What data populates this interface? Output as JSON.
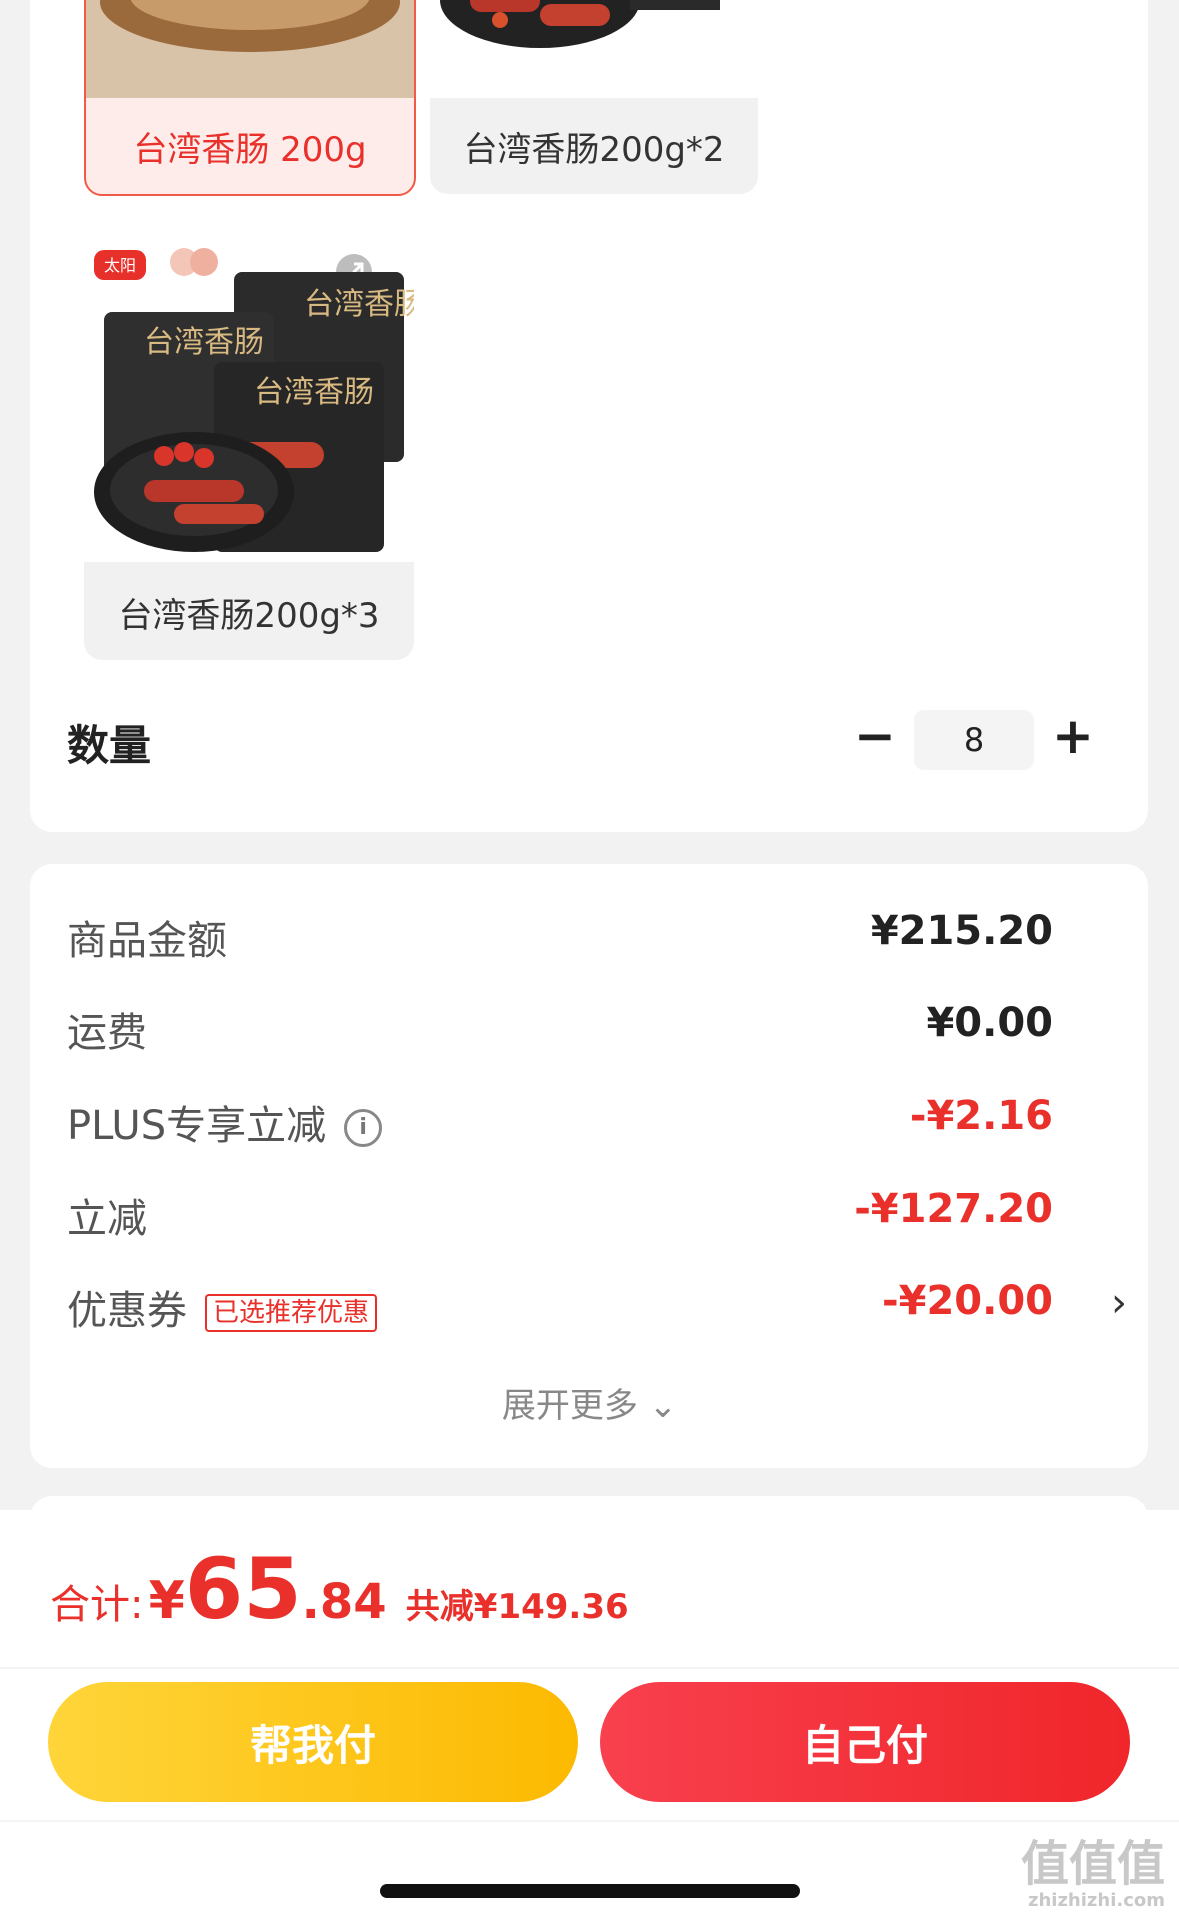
{
  "specs": [
    {
      "label": "台湾香肠 200g",
      "selected": true
    },
    {
      "label": "台湾香肠200g*2",
      "selected": false
    },
    {
      "label": "台湾香肠200g*3",
      "selected": false
    }
  ],
  "product_image": {
    "brand": "太阳",
    "bag_text": "台湾香肠"
  },
  "quantity": {
    "title": "数量",
    "minus": "−",
    "value": "8",
    "plus": "+"
  },
  "price_rows": {
    "goods_amount": {
      "label": "商品金额",
      "value": "¥215.20"
    },
    "shipping": {
      "label": "运费",
      "value": "¥0.00"
    },
    "plus_discount": {
      "label": "PLUS专享立减",
      "value": "-¥2.16",
      "icon": "i"
    },
    "instant_discount": {
      "label": "立减",
      "value": "-¥127.20"
    },
    "coupon": {
      "label": "优惠券",
      "tag": "已选推荐优惠",
      "value": "-¥20.00",
      "arrow": "›"
    }
  },
  "expand_more": "展开更多 ⌄",
  "total": {
    "label": "合计:",
    "currency": "¥",
    "integer": "65",
    "decimal": ".84",
    "saved": "共减¥149.36"
  },
  "buttons": {
    "help_pay": "帮我付",
    "self_pay": "自己付"
  },
  "watermark": {
    "main": "值值值",
    "sub": "zhizhizhi.com"
  },
  "colors": {
    "accent_red": "#e9302a",
    "yellow": "#fcb900"
  }
}
